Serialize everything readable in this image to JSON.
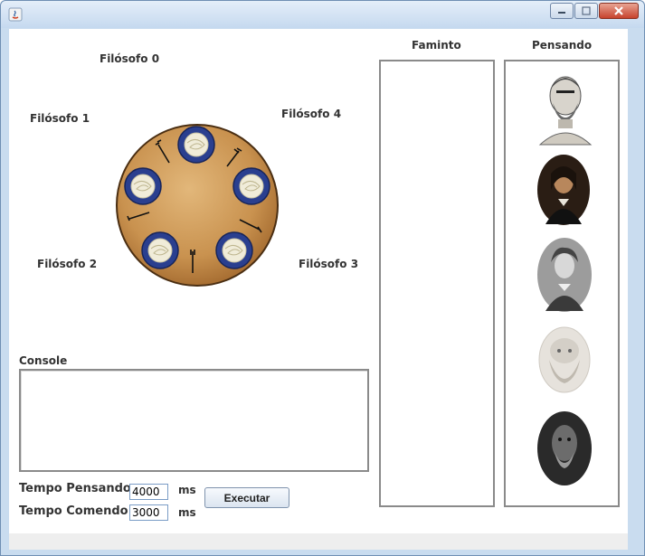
{
  "window": {
    "title": ""
  },
  "table": {
    "philosophers": [
      "Filósofo 0",
      "Filósofo 1",
      "Filósofo 2",
      "Filósofo 3",
      "Filósofo 4"
    ]
  },
  "console": {
    "label": "Console",
    "text": ""
  },
  "controls": {
    "thinking_label": "Tempo Pensando",
    "thinking_value": "4000",
    "eating_label": "Tempo Comendo",
    "eating_value": "3000",
    "unit": "ms",
    "execute_label": "Executar"
  },
  "columns": {
    "hungry": "Faminto",
    "thinking": "Pensando"
  },
  "thinking_portraits": [
    "bust-portrait-1",
    "portrait-2",
    "portrait-3",
    "bust-portrait-4",
    "portrait-5"
  ]
}
